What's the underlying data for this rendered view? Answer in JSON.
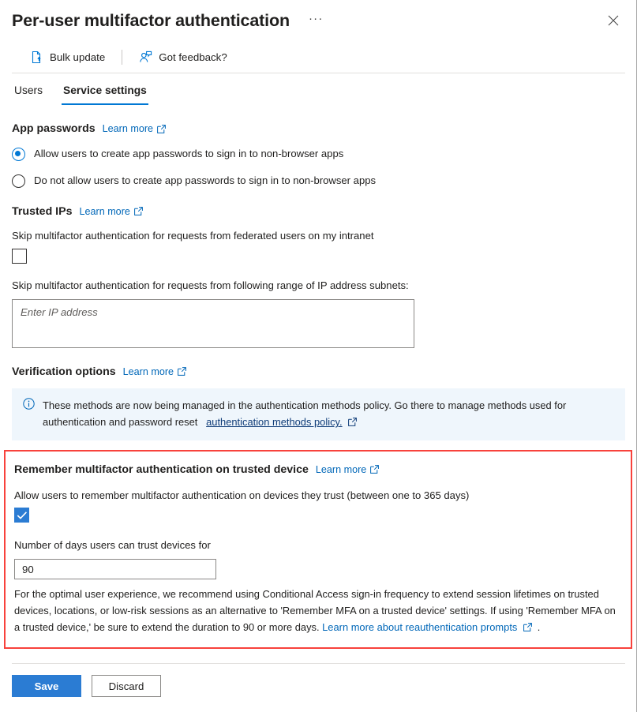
{
  "header": {
    "title": "Per-user multifactor authentication",
    "ellipsis_label": "···",
    "more_icon": "ellipsis-icon",
    "close_icon": "close-icon"
  },
  "commandbar": {
    "items": [
      {
        "label": "Bulk update",
        "icon": "document-upload-icon"
      },
      {
        "label": "Got feedback?",
        "icon": "person-feedback-icon"
      }
    ]
  },
  "tabs": [
    {
      "label": "Users",
      "active": false
    },
    {
      "label": "Service settings",
      "active": true
    }
  ],
  "learn_more_label": "Learn more",
  "sections": {
    "app_passwords": {
      "title": "App passwords",
      "learn_more": "Learn more",
      "options": [
        {
          "label": "Allow users to create app passwords to sign in to non-browser apps",
          "selected": true
        },
        {
          "label": "Do not allow users to create app passwords to sign in to non-browser apps",
          "selected": false
        }
      ]
    },
    "trusted_ips": {
      "title": "Trusted IPs",
      "learn_more": "Learn more",
      "checkbox_label": "Skip multifactor authentication for requests from federated users on my intranet",
      "checkbox_checked": false,
      "subnets_label": "Skip multifactor authentication for requests from following range of IP address subnets:",
      "subnets_value": "",
      "subnets_placeholder": "Enter IP address"
    },
    "verification_options": {
      "title": "Verification options",
      "learn_more": "Learn more",
      "info_icon": "info-circle-icon",
      "info_text": "These methods are now being managed in the authentication methods policy. Go there to manage methods used for authentication and password reset",
      "info_link": "authentication methods policy."
    },
    "remember_mfa": {
      "title": "Remember multifactor authentication on trusted device",
      "learn_more": "Learn more",
      "allow_label": "Allow users to remember multifactor authentication on devices they trust (between one to 365 days)",
      "allow_checked": true,
      "days_label": "Number of days users can trust devices for",
      "days_value": "90",
      "fineprint_before": "For the optimal user experience, we recommend using Conditional Access sign-in frequency to extend session lifetimes on trusted devices, locations, or low-risk sessions as an alternative to 'Remember MFA on a trusted device' settings. If using 'Remember MFA on a trusted device,' be sure to extend the duration to 90 or more days.",
      "fineprint_link": "Learn more about reauthentication prompts",
      "fineprint_after": ".",
      "highlight_color": "#f8423c"
    }
  },
  "footer": {
    "save_label": "Save",
    "discard_label": "Discard"
  },
  "colors": {
    "accent": "#0078d4",
    "link": "#0067b8",
    "primary_button": "#2b7cd3",
    "info_background": "#eff6fc",
    "highlight_border": "#f8423c"
  }
}
